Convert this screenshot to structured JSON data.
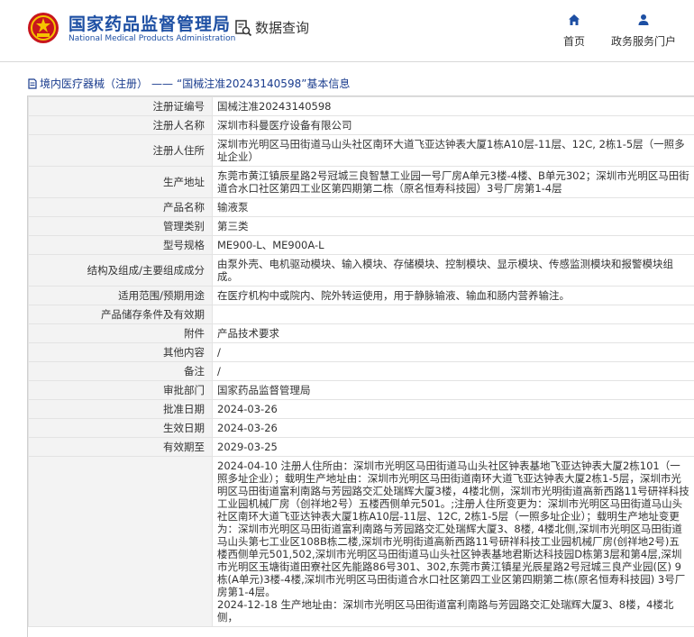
{
  "header": {
    "site_name_cn": "国家药品监督管理局",
    "site_name_en": "National Medical Products Administration",
    "data_query": "数据查询",
    "nav": [
      {
        "label": "首页",
        "icon": "home-icon"
      },
      {
        "label": "政务服务门户",
        "icon": "user-icon"
      }
    ]
  },
  "breadcrumb": {
    "category": "境内医疗器械（注册）",
    "separator": "——",
    "current": "“国械注准20243140598”基本信息"
  },
  "rows": [
    {
      "key": "注册证编号",
      "value": "国械注准20243140598"
    },
    {
      "key": "注册人名称",
      "value": "深圳市科曼医疗设备有限公司"
    },
    {
      "key": "注册人住所",
      "value": "深圳市光明区马田街道马山头社区南环大道飞亚达钟表大厦1栋A10层-11层、12C, 2栋1-5层（一照多址企业）"
    },
    {
      "key": "生产地址",
      "value": "东莞市黄江镇辰星路2号冠城三良智慧工业园一号厂房A单元3楼-4楼、B单元302；深圳市光明区马田街道合水口社区第四工业区第四期第二栋（原名恒寿科技园）3号厂房第1-4层"
    },
    {
      "key": "产品名称",
      "value": "输液泵"
    },
    {
      "key": "管理类别",
      "value": "第三类"
    },
    {
      "key": "型号规格",
      "value": "ME900-L、ME900A-L"
    },
    {
      "key": "结构及组成/主要组成成分",
      "value": "由泵外壳、电机驱动模块、输入模块、存储模块、控制模块、显示模块、传感监测模块和报警模块组成。"
    },
    {
      "key": "适用范围/预期用途",
      "value": "在医疗机构中或院内、院外转运使用，用于静脉输液、输血和肠内营养输注。"
    },
    {
      "key": "产品储存条件及有效期",
      "value": ""
    },
    {
      "key": "附件",
      "value": "产品技术要求"
    },
    {
      "key": "其他内容",
      "value": "/"
    },
    {
      "key": "备注",
      "value": "/"
    },
    {
      "key": "审批部门",
      "value": "国家药品监督管理局"
    },
    {
      "key": "批准日期",
      "value": "2024-03-26"
    },
    {
      "key": "生效日期",
      "value": "2024-03-26"
    },
    {
      "key": "有效期至",
      "value": "2029-03-25"
    },
    {
      "key": "",
      "value": "2024-04-10 注册人住所由：深圳市光明区马田街道马山头社区钟表基地飞亚达钟表大厦2栋101（一照多址企业）；载明生产地址由：深圳市光明区马田街道南环大道飞亚达钟表大厦2栋1-5层，深圳市光明区马田街道富利南路与芳园路交汇处瑞辉大厦3楼，4楼北侧，深圳市光明街道高新西路11号研祥科技工业园机械厂房（创祥地2号）五楼西侧单元501。;注册人住所变更为：深圳市光明区马田街道马山头社区南环大道飞亚达钟表大厦1栋A10层-11层、12C, 2栋1-5层（一照多址企业）；载明生产地址变更为：深圳市光明区马田街道富利南路与芳园路交汇处瑞辉大厦3、8楼, 4楼北侧,深圳市光明区马田街道马山头第七工业区108B栋二楼,深圳市光明街道高新西路11号研祥科技工业园机械厂房(创祥地2号)五楼西侧单元501,502,深圳市光明区马田街道马山头社区钟表基地君斯达科技园D栋第3层和第4层,深圳市光明区玉塘街道田寮社区先能路86号301、302,东莞市黄江镇星光辰星路2号冠城三良产业园(区) 9栋(A单元)3楼-4楼,深圳市光明区马田街道合水口社区第四工业区第四期第二栋(原名恒寿科技园) 3号厂房第1-4层。\n2024-12-18 生产地址由：深圳市光明区马田街道富利南路与芳园路交汇处瑞辉大厦3、8楼，4楼北侧，"
    }
  ]
}
